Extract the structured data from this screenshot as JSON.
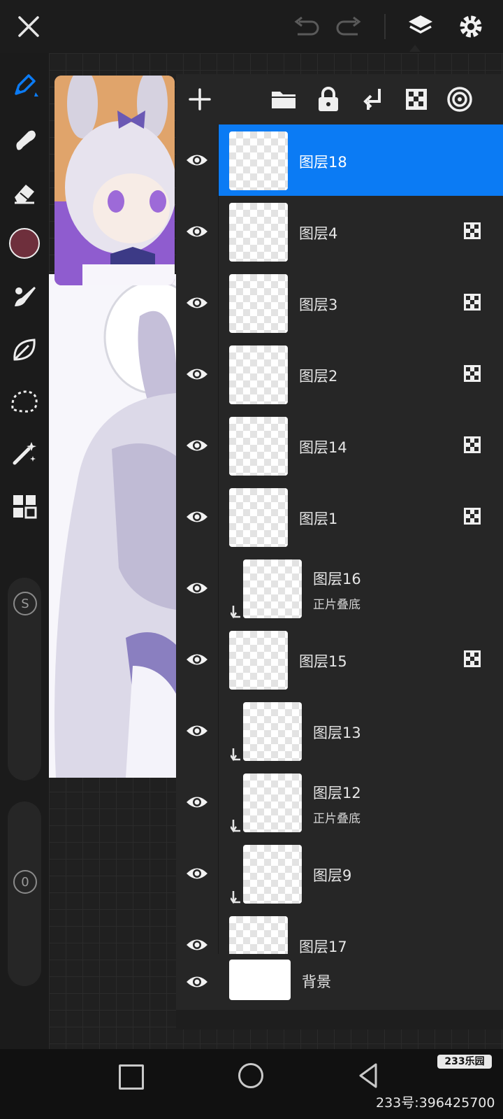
{
  "toolbar": {
    "brush_color": "#6e2f3c",
    "accent": "#0b7bf4",
    "icons": [
      "brush-icon",
      "smudge-icon",
      "eraser-icon",
      "color-swatch",
      "mixer-brush-icon",
      "liquify-icon",
      "selection-icon",
      "magic-wand-icon",
      "panels-icon"
    ],
    "size_label": "S",
    "opacity_label": "0"
  },
  "layers": {
    "rows": [
      {
        "name": "图层18",
        "selected": true,
        "clipped": false,
        "alpha_lock": false,
        "mode": ""
      },
      {
        "name": "图层4",
        "selected": false,
        "clipped": false,
        "alpha_lock": true,
        "mode": ""
      },
      {
        "name": "图层3",
        "selected": false,
        "clipped": false,
        "alpha_lock": true,
        "mode": ""
      },
      {
        "name": "图层2",
        "selected": false,
        "clipped": false,
        "alpha_lock": true,
        "mode": ""
      },
      {
        "name": "图层14",
        "selected": false,
        "clipped": false,
        "alpha_lock": true,
        "mode": ""
      },
      {
        "name": "图层1",
        "selected": false,
        "clipped": false,
        "alpha_lock": true,
        "mode": ""
      },
      {
        "name": "图层16",
        "selected": false,
        "clipped": true,
        "alpha_lock": false,
        "mode": "正片叠底"
      },
      {
        "name": "图层15",
        "selected": false,
        "clipped": false,
        "alpha_lock": true,
        "mode": ""
      },
      {
        "name": "图层13",
        "selected": false,
        "clipped": true,
        "alpha_lock": false,
        "mode": ""
      },
      {
        "name": "图层12",
        "selected": false,
        "clipped": true,
        "alpha_lock": false,
        "mode": "正片叠底"
      },
      {
        "name": "图层9",
        "selected": false,
        "clipped": true,
        "alpha_lock": false,
        "mode": ""
      },
      {
        "name": "图层17",
        "selected": false,
        "clipped": false,
        "alpha_lock": false,
        "mode": ""
      }
    ],
    "background_label": "背景"
  },
  "watermark": {
    "badge": "233乐园",
    "id_text": "233号:396425700"
  }
}
